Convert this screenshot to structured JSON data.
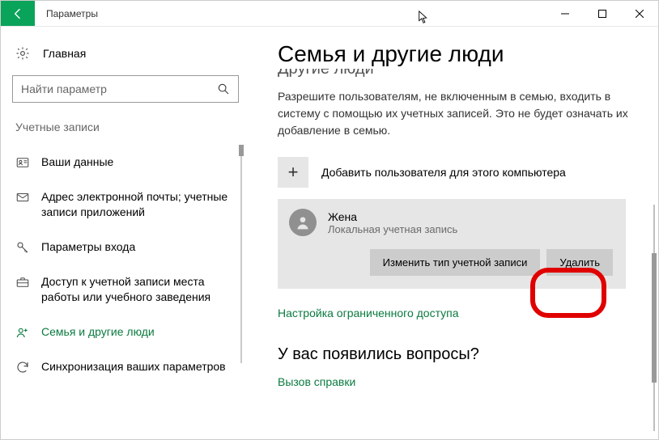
{
  "titlebar": {
    "app_title": "Параметры"
  },
  "sidebar": {
    "home": "Главная",
    "search_placeholder": "Найти параметр",
    "section": "Учетные записи",
    "items": [
      {
        "label": "Ваши данные"
      },
      {
        "label": "Адрес электронной почты; учетные записи приложений"
      },
      {
        "label": "Параметры входа"
      },
      {
        "label": "Доступ к учетной записи места работы или учебного заведения"
      },
      {
        "label": "Семья и другие люди"
      },
      {
        "label": "Синхронизация ваших параметров"
      }
    ]
  },
  "main": {
    "title": "Семья и другие люди",
    "cut_heading": "Другие люди",
    "description": "Разрешите пользователям, не включенным в семью, входить в систему с помощью их учетных записей. Это не будет означать их добавление в семью.",
    "add_user": "Добавить пользователя для этого компьютера",
    "user": {
      "name": "Жена",
      "type": "Локальная учетная запись"
    },
    "change_type_btn": "Изменить тип учетной записи",
    "delete_btn": "Удалить",
    "kiosk_link": "Настройка ограниченного доступа",
    "questions_heading": "У вас появились вопросы?",
    "help_link": "Вызов справки"
  }
}
